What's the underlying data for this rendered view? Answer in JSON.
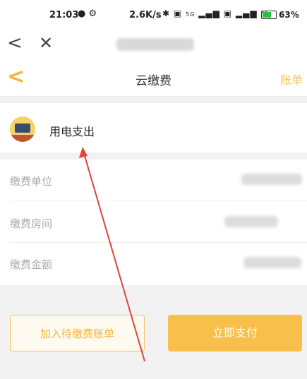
{
  "statusbar": {
    "time": "21:03",
    "speed": "2.6K/s",
    "signal": "5G",
    "battery_pct": "63%"
  },
  "browser": {
    "back_glyph": "<",
    "close_glyph": "✕"
  },
  "appbar": {
    "title": "云缴费",
    "bills_link": "账单"
  },
  "item": {
    "label": "用电支出",
    "icon": "computer-icon"
  },
  "form": {
    "rows": [
      {
        "label": "缴费单位"
      },
      {
        "label": "缴费房间"
      },
      {
        "label": "缴费金额"
      }
    ]
  },
  "actions": {
    "add_pending": "加入待缴费账单",
    "pay_now": "立即支付"
  },
  "colors": {
    "accent": "#f8bf4a",
    "annotation": "#e0443a"
  }
}
